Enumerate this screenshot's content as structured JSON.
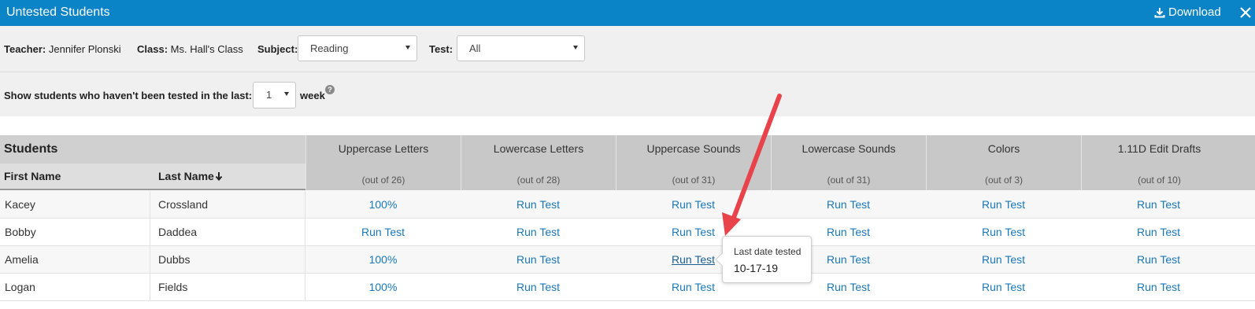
{
  "titlebar": {
    "title": "Untested Students",
    "download_label": "Download",
    "download_icon": "download-icon",
    "close_icon": "close-icon"
  },
  "filters": {
    "teacher_label": "Teacher:",
    "teacher_value": "Jennifer Plonski",
    "class_label": "Class:",
    "class_value": "Ms. Hall's Class",
    "subject_label": "Subject:",
    "subject_value": "Reading",
    "test_label": "Test:",
    "test_value": "All"
  },
  "window": {
    "prompt": "Show students who haven't been tested in the last:",
    "value": "1",
    "unit": "week",
    "help": "?"
  },
  "table": {
    "students_header": "Students",
    "first_name_header": "First Name",
    "last_name_header": "Last Name",
    "tests": [
      {
        "name": "Uppercase Letters",
        "out_of": "(out of 26)"
      },
      {
        "name": "Lowercase Letters",
        "out_of": "(out of 28)"
      },
      {
        "name": "Uppercase Sounds",
        "out_of": "(out of 31)"
      },
      {
        "name": "Lowercase Sounds",
        "out_of": "(out of 31)"
      },
      {
        "name": "Colors",
        "out_of": "(out of 3)"
      },
      {
        "name": "1.11D Edit Drafts",
        "out_of": "(out of 10)"
      }
    ],
    "rows": [
      {
        "first": "Kacey",
        "last": "Crossland",
        "scores": [
          "100%",
          "Run Test",
          "Run Test",
          "Run Test",
          "Run Test",
          "Run Test"
        ]
      },
      {
        "first": "Bobby",
        "last": "Daddea",
        "scores": [
          "Run Test",
          "Run Test",
          "Run Test",
          "Run Test",
          "Run Test",
          "Run Test"
        ]
      },
      {
        "first": "Amelia",
        "last": "Dubbs",
        "scores": [
          "100%",
          "Run Test",
          "Run Test",
          "Run Test",
          "Run Test",
          "Run Test"
        ]
      },
      {
        "first": "Logan",
        "last": "Fields",
        "scores": [
          "100%",
          "Run Test",
          "Run Test",
          "Run Test",
          "Run Test",
          "Run Test"
        ]
      }
    ]
  },
  "tooltip": {
    "label": "Last date tested",
    "date": "10-17-19"
  },
  "colors": {
    "titlebar": "#0a84c6",
    "link": "#1a78b8",
    "annotation_arrow": "#e8434a"
  }
}
